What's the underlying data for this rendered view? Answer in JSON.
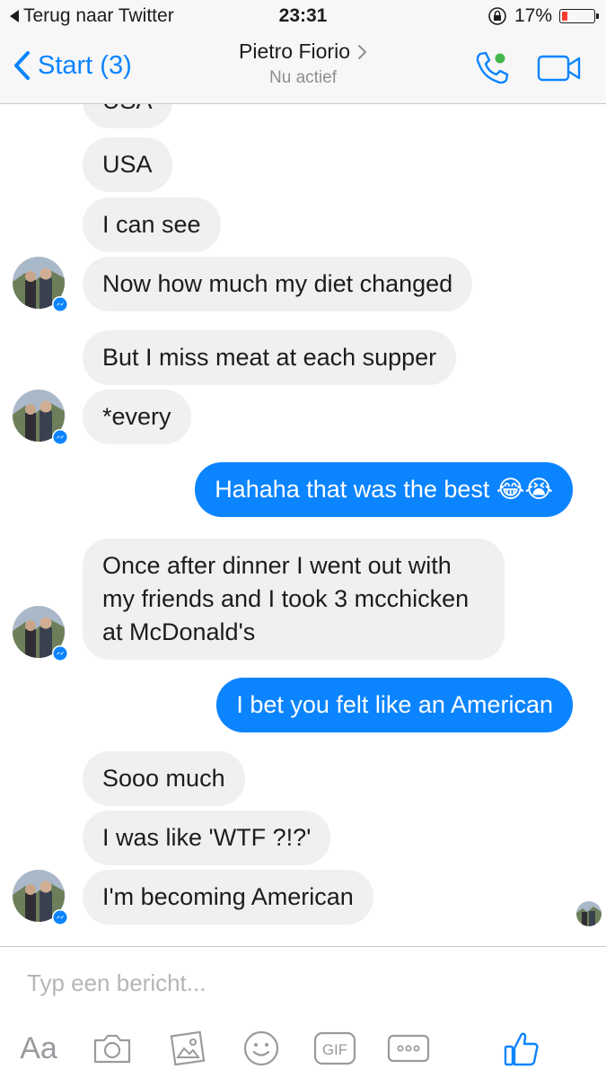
{
  "status_bar": {
    "back_label": "Terug naar Twitter",
    "time": "23:31",
    "battery_text": "17%",
    "battery_level": 0.17
  },
  "nav": {
    "back_label": "Start (3)",
    "name": "Pietro Fiorio",
    "status": "Nu actief",
    "accent_color": "#0b84ff",
    "online_color": "#44b74c"
  },
  "messages": [
    {
      "from": "them",
      "text": "USA"
    },
    {
      "from": "them",
      "text": "USA"
    },
    {
      "from": "them",
      "text": "I can see"
    },
    {
      "from": "them",
      "text": "Now how much my diet changed"
    },
    {
      "from": "them",
      "text": "But I miss meat at each supper"
    },
    {
      "from": "them",
      "text": "*every"
    },
    {
      "from": "me",
      "text": "Hahaha that was the best 😂😭"
    },
    {
      "from": "them",
      "text": "Once after dinner I went out with my friends and I took 3 mcchicken at McDonald's"
    },
    {
      "from": "me",
      "text": "I bet you felt like an American"
    },
    {
      "from": "them",
      "text": "Sooo much"
    },
    {
      "from": "them",
      "text": "I was like 'WTF ?!?'"
    },
    {
      "from": "them",
      "text": "I'm becoming American"
    }
  ],
  "composer": {
    "placeholder": "Typ een bericht...",
    "text_tool_label": "Aa",
    "gif_label": "GIF"
  },
  "icons": [
    "chevron-left-icon",
    "chevron-right-icon",
    "lock-rotation-icon",
    "battery-icon",
    "phone-icon",
    "video-camera-icon",
    "messenger-badge-icon",
    "camera-icon",
    "photo-gallery-icon",
    "smiley-icon",
    "more-icon",
    "thumbs-up-icon"
  ]
}
